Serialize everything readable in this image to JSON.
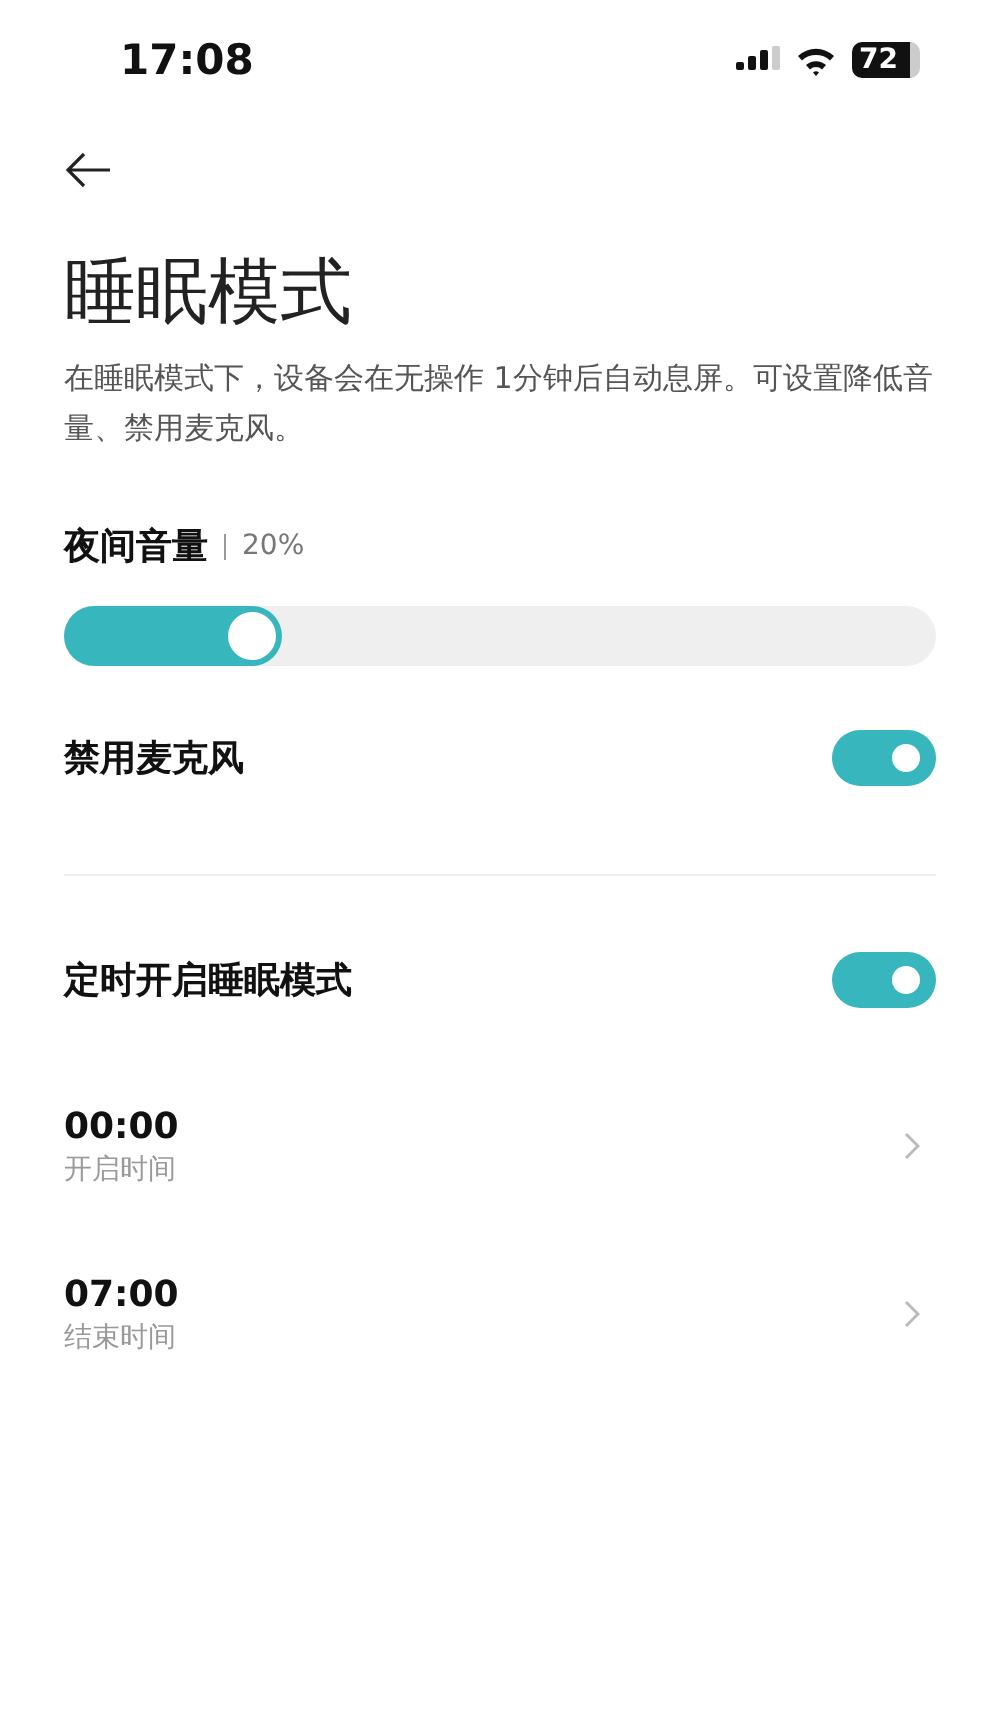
{
  "status_bar": {
    "time": "17:08",
    "battery": "72"
  },
  "title": "睡眠模式",
  "description": "在睡眠模式下，设备会在无操作 1分钟后自动息屏。可设置降低音量、禁用麦克风。",
  "volume": {
    "label": "夜间音量",
    "reading": "20%",
    "level": 0.25
  },
  "settings": [
    {
      "kind": "toggle",
      "label": "禁用麦克风",
      "on": true
    },
    {
      "kind": "divider"
    },
    {
      "kind": "toggle",
      "label": "定时开启睡眠模式",
      "on": true
    },
    {
      "kind": "time",
      "value": "00:00",
      "caption": "开启时间"
    },
    {
      "kind": "time",
      "value": "07:00",
      "caption": "结束时间"
    }
  ]
}
